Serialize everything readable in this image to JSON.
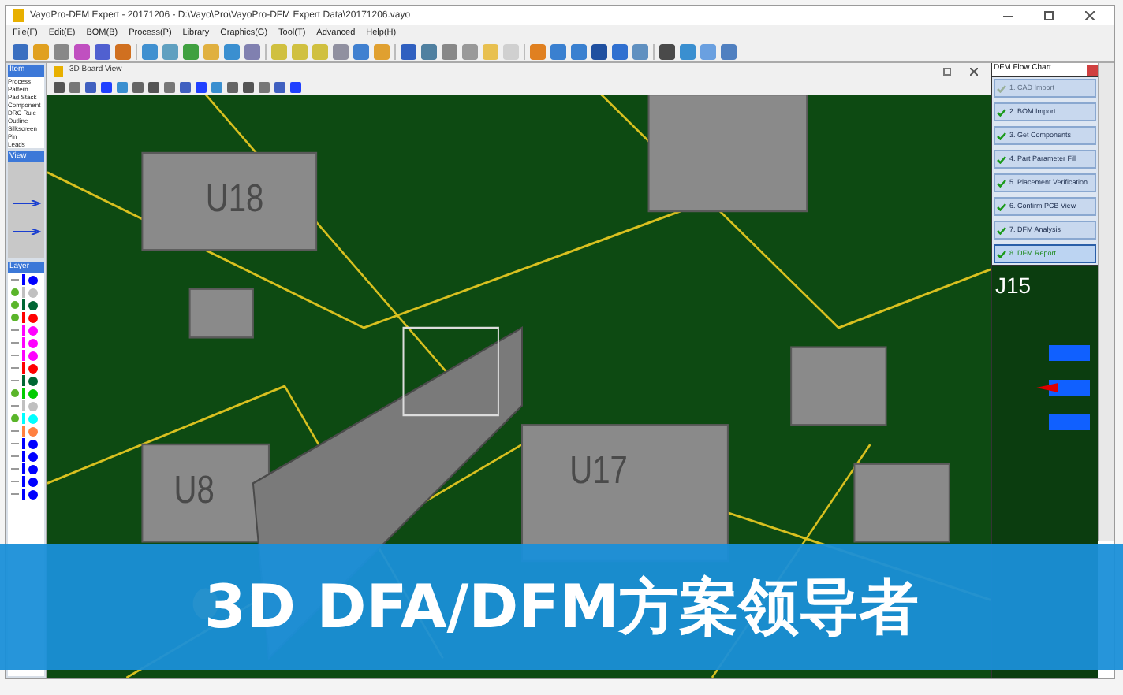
{
  "window": {
    "title": "VayoPro-DFM Expert - 20171206 - D:\\Vayo\\Pro\\VayoPro-DFM Expert Data\\20171206.vayo"
  },
  "menu": [
    "File(F)",
    "Edit(E)",
    "BOM(B)",
    "Process(P)",
    "Library",
    "Graphics(G)",
    "Tool(T)",
    "Advanced",
    "Help(H)"
  ],
  "left_panel": {
    "items_title": "Item",
    "items": [
      "Process",
      "Pattern",
      "Pad Stack",
      "Component",
      "DRC Rule",
      "Outline",
      "Silkscreen",
      "Pin",
      "Leads"
    ],
    "view_title": "View",
    "layers_title": "Layer",
    "layers": [
      {
        "visible": false,
        "color": "#0000ff"
      },
      {
        "visible": true,
        "color": "#c0c0c0"
      },
      {
        "visible": true,
        "color": "#006633"
      },
      {
        "visible": true,
        "color": "#ff0000"
      },
      {
        "visible": false,
        "color": "#ff00ff"
      },
      {
        "visible": false,
        "color": "#ff00ff"
      },
      {
        "visible": false,
        "color": "#ff00ff"
      },
      {
        "visible": false,
        "color": "#ff0000"
      },
      {
        "visible": false,
        "color": "#006633"
      },
      {
        "visible": true,
        "color": "#00cc00"
      },
      {
        "visible": false,
        "color": "#c0c0c0"
      },
      {
        "visible": true,
        "color": "#00ffff"
      },
      {
        "visible": false,
        "color": "#ff8040"
      },
      {
        "visible": false,
        "color": "#0000ff"
      },
      {
        "visible": false,
        "color": "#0000ff"
      },
      {
        "visible": false,
        "color": "#0000ff"
      },
      {
        "visible": false,
        "color": "#0000ff"
      },
      {
        "visible": false,
        "color": "#0000ff"
      }
    ]
  },
  "board_view": {
    "title": "3D Board View",
    "chips": [
      "U18",
      "U17",
      "U8"
    ]
  },
  "flow_chart": {
    "title": "DFM Flow Chart",
    "steps": [
      {
        "label": "1. CAD Import",
        "disabled": true,
        "current": false
      },
      {
        "label": "2. BOM Import",
        "disabled": false,
        "current": false
      },
      {
        "label": "3. Get Components",
        "disabled": false,
        "current": false
      },
      {
        "label": "4. Part Parameter Fill",
        "disabled": false,
        "current": false
      },
      {
        "label": "5. Placement Verification",
        "disabled": false,
        "current": false
      },
      {
        "label": "6. Confirm PCB View",
        "disabled": false,
        "current": false
      },
      {
        "label": "7. DFM Analysis",
        "disabled": false,
        "current": false
      },
      {
        "label": "8. DFM Report",
        "disabled": false,
        "current": true
      }
    ]
  },
  "side_view": {
    "label": "J15"
  },
  "banner": {
    "text": "3D DFA/DFM方案领导者"
  }
}
